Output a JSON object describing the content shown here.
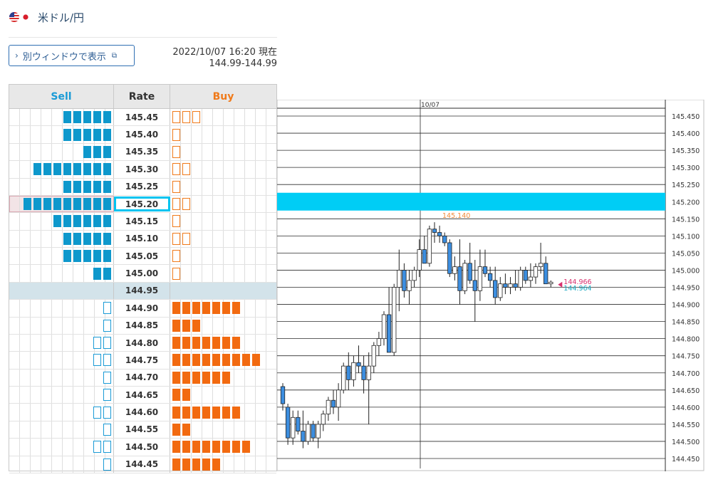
{
  "header": {
    "pair_label": "米ドル/円",
    "popout_label": "別ウィンドウで表示",
    "timestamp": "2022/10/07 16:20 現在",
    "bid_ask": "144.99-144.99"
  },
  "book": {
    "headers": {
      "sell": "Sell",
      "rate": "Rate",
      "buy": "Buy"
    },
    "current_rate": "144.95",
    "selected_rate": "145.20",
    "rows": [
      {
        "rate": "145.45",
        "sell": 5,
        "sell_outline": false,
        "buy": 3,
        "buy_outline": true
      },
      {
        "rate": "145.40",
        "sell": 5,
        "sell_outline": false,
        "buy": 1,
        "buy_outline": true
      },
      {
        "rate": "145.35",
        "sell": 3,
        "sell_outline": false,
        "buy": 1,
        "buy_outline": true
      },
      {
        "rate": "145.30",
        "sell": 8,
        "sell_outline": false,
        "buy": 2,
        "buy_outline": true
      },
      {
        "rate": "145.25",
        "sell": 5,
        "sell_outline": false,
        "buy": 1,
        "buy_outline": true
      },
      {
        "rate": "145.20",
        "sell": 9,
        "sell_outline": false,
        "buy": 2,
        "buy_outline": true
      },
      {
        "rate": "145.15",
        "sell": 6,
        "sell_outline": false,
        "buy": 1,
        "buy_outline": true
      },
      {
        "rate": "145.10",
        "sell": 5,
        "sell_outline": false,
        "buy": 2,
        "buy_outline": true
      },
      {
        "rate": "145.05",
        "sell": 5,
        "sell_outline": false,
        "buy": 1,
        "buy_outline": true
      },
      {
        "rate": "145.00",
        "sell": 2,
        "sell_outline": false,
        "buy": 1,
        "buy_outline": true
      },
      {
        "rate": "144.95",
        "sell": 0,
        "sell_outline": false,
        "buy": 0,
        "buy_outline": false
      },
      {
        "rate": "144.90",
        "sell": 1,
        "sell_outline": true,
        "buy": 7,
        "buy_outline": false
      },
      {
        "rate": "144.85",
        "sell": 1,
        "sell_outline": true,
        "buy": 3,
        "buy_outline": false
      },
      {
        "rate": "144.80",
        "sell": 2,
        "sell_outline": true,
        "buy": 7,
        "buy_outline": false
      },
      {
        "rate": "144.75",
        "sell": 2,
        "sell_outline": true,
        "buy": 9,
        "buy_outline": false
      },
      {
        "rate": "144.70",
        "sell": 1,
        "sell_outline": true,
        "buy": 6,
        "buy_outline": false
      },
      {
        "rate": "144.65",
        "sell": 1,
        "sell_outline": true,
        "buy": 2,
        "buy_outline": false
      },
      {
        "rate": "144.60",
        "sell": 2,
        "sell_outline": true,
        "buy": 7,
        "buy_outline": false
      },
      {
        "rate": "144.55",
        "sell": 1,
        "sell_outline": true,
        "buy": 2,
        "buy_outline": false
      },
      {
        "rate": "144.50",
        "sell": 2,
        "sell_outline": true,
        "buy": 8,
        "buy_outline": false
      },
      {
        "rate": "144.45",
        "sell": 1,
        "sell_outline": true,
        "buy": 5,
        "buy_outline": false
      }
    ]
  },
  "chart": {
    "date_label": "10/07",
    "high_label": "145.140",
    "bid_label": "144.966",
    "ask_label": "144.964",
    "colors": {
      "up": "#ffffff",
      "down": "#3c8ee0",
      "band": "#00cdf5",
      "high": "#f08a3a",
      "bid": "#d8306e",
      "ask": "#1aa8c0",
      "grid": "#2b2b2b"
    }
  },
  "chart_data": {
    "type": "candlestick",
    "y_ticks": [
      "145.450",
      "145.400",
      "145.350",
      "145.300",
      "145.250",
      "145.200",
      "145.150",
      "145.100",
      "145.050",
      "145.000",
      "144.950",
      "144.900",
      "144.850",
      "144.800",
      "144.750",
      "144.700",
      "144.650",
      "144.600",
      "144.550",
      "144.500",
      "144.450"
    ],
    "ylim": [
      144.43,
      145.475
    ],
    "band_rate": 145.2,
    "high_marker": 145.14,
    "bid": 144.966,
    "ask": 144.964,
    "candles": [
      [
        144.66,
        144.67,
        144.59,
        144.61
      ],
      [
        144.6,
        144.61,
        144.49,
        144.51
      ],
      [
        144.51,
        144.59,
        144.49,
        144.57
      ],
      [
        144.57,
        144.59,
        144.52,
        144.53
      ],
      [
        144.53,
        144.59,
        144.48,
        144.5
      ],
      [
        144.5,
        144.56,
        144.49,
        144.55
      ],
      [
        144.55,
        144.56,
        144.5,
        144.51
      ],
      [
        144.51,
        144.56,
        144.48,
        144.55
      ],
      [
        144.55,
        144.59,
        144.53,
        144.58
      ],
      [
        144.58,
        144.63,
        144.56,
        144.62
      ],
      [
        144.62,
        144.65,
        144.58,
        144.6
      ],
      [
        144.6,
        144.67,
        144.56,
        144.65
      ],
      [
        144.65,
        144.73,
        144.64,
        144.72
      ],
      [
        144.72,
        144.76,
        144.65,
        144.68
      ],
      [
        144.68,
        144.75,
        144.66,
        144.73
      ],
      [
        144.73,
        144.78,
        144.7,
        144.72
      ],
      [
        144.72,
        144.75,
        144.64,
        144.68
      ],
      [
        144.68,
        144.76,
        144.55,
        144.72
      ],
      [
        144.72,
        144.79,
        144.7,
        144.78
      ],
      [
        144.78,
        144.82,
        144.75,
        144.8
      ],
      [
        144.8,
        144.88,
        144.78,
        144.87
      ],
      [
        144.87,
        144.95,
        144.76,
        144.76
      ],
      [
        144.76,
        144.96,
        144.75,
        144.95
      ],
      [
        144.95,
        145.06,
        144.88,
        145.0
      ],
      [
        145.0,
        145.02,
        144.92,
        144.94
      ],
      [
        144.94,
        145.0,
        144.9,
        144.97
      ],
      [
        144.97,
        145.01,
        144.95,
        145.0
      ],
      [
        145.0,
        145.09,
        144.98,
        145.06
      ],
      [
        145.06,
        145.1,
        145.02,
        145.02
      ],
      [
        145.02,
        145.13,
        145.01,
        145.12
      ],
      [
        145.12,
        145.14,
        145.08,
        145.11
      ],
      [
        145.11,
        145.13,
        145.08,
        145.1
      ],
      [
        145.1,
        145.11,
        145.07,
        145.08
      ],
      [
        145.08,
        145.09,
        144.98,
        144.99
      ],
      [
        144.99,
        145.04,
        144.97,
        145.01
      ],
      [
        145.01,
        145.09,
        144.9,
        144.94
      ],
      [
        144.94,
        145.03,
        144.93,
        145.02
      ],
      [
        145.02,
        145.08,
        144.96,
        144.97
      ],
      [
        144.97,
        145.03,
        144.85,
        144.94
      ],
      [
        144.94,
        145.06,
        144.91,
        145.01
      ],
      [
        145.01,
        145.06,
        144.98,
        144.99
      ],
      [
        144.99,
        145.01,
        144.95,
        144.97
      ],
      [
        144.97,
        145.01,
        144.9,
        144.92
      ],
      [
        144.92,
        144.98,
        144.91,
        144.96
      ],
      [
        144.96,
        144.99,
        144.93,
        144.95
      ],
      [
        144.95,
        144.98,
        144.93,
        144.96
      ],
      [
        144.96,
        145.0,
        144.94,
        144.95
      ],
      [
        144.95,
        145.01,
        144.94,
        145.0
      ],
      [
        145.0,
        145.01,
        144.96,
        144.97
      ],
      [
        144.97,
        145.02,
        144.95,
        144.98
      ],
      [
        144.98,
        145.02,
        144.96,
        145.01
      ],
      [
        145.01,
        145.08,
        144.99,
        145.02
      ],
      [
        145.02,
        145.04,
        144.96,
        144.96
      ],
      [
        144.96,
        144.97,
        144.95,
        144.965
      ]
    ]
  }
}
